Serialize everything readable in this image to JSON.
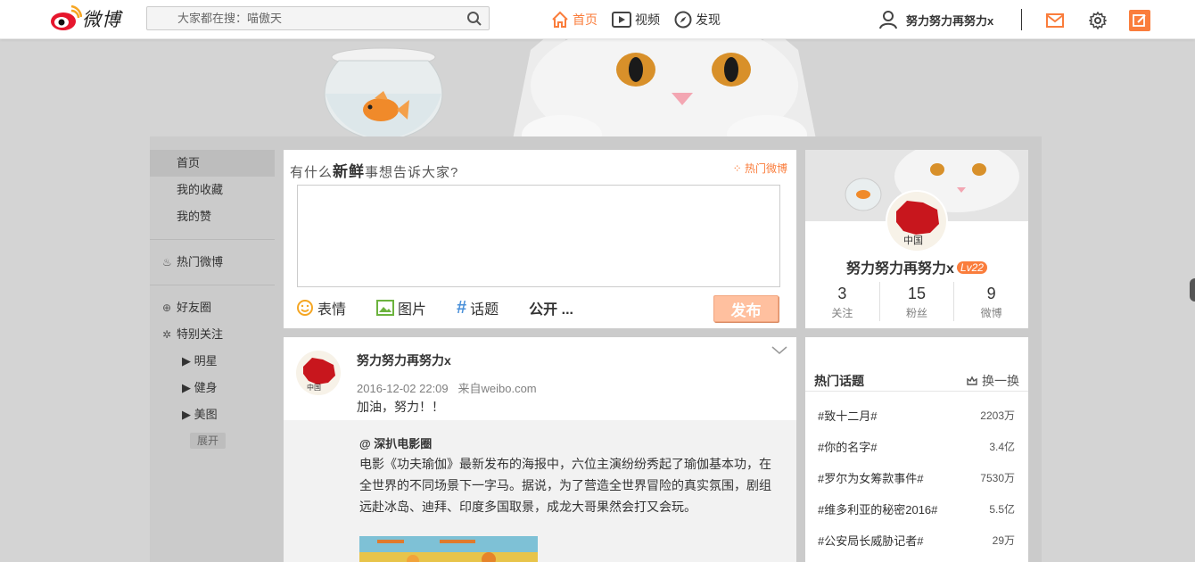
{
  "header": {
    "logo_text": "微博",
    "search_placeholder": "大家都在搜：喵傲天",
    "nav": [
      {
        "label": "首页",
        "icon": "home-icon"
      },
      {
        "label": "视频",
        "icon": "video-icon"
      },
      {
        "label": "发现",
        "icon": "compass-icon"
      }
    ],
    "user_name": "努力努力再努力x",
    "accent": "#fa7d3c"
  },
  "sidebar": {
    "items": [
      "首页",
      "我的收藏",
      "我的赞"
    ],
    "hot_weibo": "热门微博",
    "friends_circle": "好友圈",
    "special_follow": "特别关注",
    "groups": [
      "明星",
      "健身",
      "美图"
    ],
    "expand": "展开"
  },
  "publisher": {
    "title_pre": "有什么",
    "title_bold": "新鲜",
    "title_post": "事想告诉大家?",
    "hot_link": "热门微博",
    "tools": {
      "emoji": "表情",
      "image": "图片",
      "topic": "话题",
      "visibility": "公开 ..."
    },
    "submit": "发布"
  },
  "feed": {
    "author": "努力努力再努力x",
    "time": "2016-12-02 22:09",
    "source": "来自weibo.com",
    "text": "加油，努力！！",
    "repost": {
      "author": "@ 深扒电影圈",
      "text": "电影《功夫瑜伽》最新发布的海报中，六位主演纷纷秀起了瑜伽基本功，在全世界的不同场景下一字马。据说，为了营造全世界冒险的真实氛围，剧组远赴冰岛、迪拜、印度多国取景，成龙大哥果然会打又会玩。"
    }
  },
  "profile": {
    "name": "努力努力再努力x",
    "level": "Lv22",
    "stats": [
      {
        "num": "3",
        "label": "关注"
      },
      {
        "num": "15",
        "label": "粉丝"
      },
      {
        "num": "9",
        "label": "微博"
      }
    ]
  },
  "hot_topics": {
    "title": "热门话题",
    "refresh": "换一换",
    "items": [
      {
        "topic": "#致十二月#",
        "count": "2203万"
      },
      {
        "topic": "#你的名字#",
        "count": "3.4亿"
      },
      {
        "topic": "#罗尔为女筹款事件#",
        "count": "7530万"
      },
      {
        "topic": "#维多利亚的秘密2016#",
        "count": "5.5亿"
      },
      {
        "topic": "#公安局长威胁记者#",
        "count": "29万"
      }
    ]
  }
}
